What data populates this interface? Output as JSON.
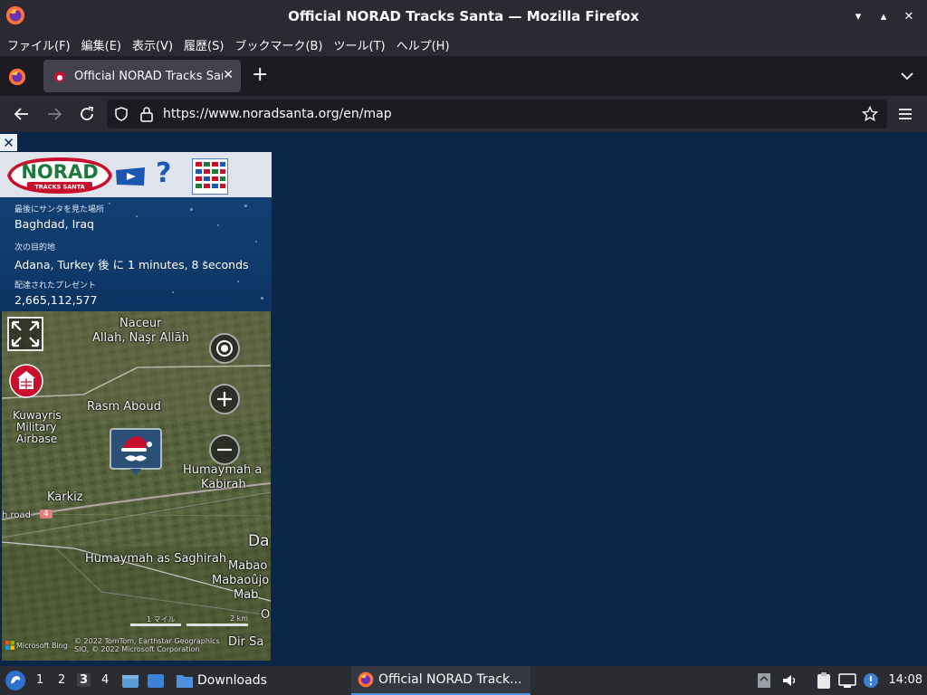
{
  "window": {
    "title": "Official NORAD Tracks Santa — Mozilla Firefox",
    "controls": [
      "▾",
      "▴",
      "✕"
    ]
  },
  "menubar": {
    "items": [
      "ファイル(F)",
      "編集(E)",
      "表示(V)",
      "履歴(S)",
      "ブックマーク(B)",
      "ツール(T)",
      "ヘルプ(H)"
    ]
  },
  "tabs": {
    "active_title": "Official NORAD Tracks Santa",
    "close": "✕",
    "new_tab": "+"
  },
  "navbar": {
    "url": "https://www.noradsanta.org/en/map"
  },
  "page": {
    "close": "✕",
    "help": "?",
    "logo_text": "NORAD",
    "logo_sub": "TRACKS SANTA",
    "last_seen_label": "最後にサンタを見た場所",
    "last_seen_value": "Baghdad, Iraq",
    "next_stop_label": "次の目的地",
    "next_stop_value": "Adana, Turkey 後 に 1 minutes, 8 seconds",
    "gifts_label": "配達されたプレゼント",
    "gifts_value": "2,665,112,577"
  },
  "map": {
    "labels": {
      "naceur": "Naceur",
      "allah": "Allah, Naşr Allāh",
      "rasm": "Rasm Aboud",
      "kuwayris1": "Kuwayris",
      "kuwayris2": "Military",
      "kuwayris3": "Airbase",
      "humaymah_a": "Humaymah a",
      "kabirah": "Kabirah",
      "karkiz": "Karkiz",
      "road": "h road",
      "road_num": "4",
      "humaymah_s": "Humaymah as Saghirah",
      "da": "Da",
      "mabao": "Mabao",
      "mabaoujo": "Mabaoûjo",
      "mab": "Mab",
      "o": "O",
      "dirsa": "Dir Sa"
    },
    "scale_mi": "1 マイル",
    "scale_km": "2 km",
    "attribution": "© 2022 TomTom, Earthstar Geographics SIO, © 2022 Microsoft Corporation",
    "bing": "Microsoft Bing"
  },
  "taskbar": {
    "workspaces": [
      "1",
      "2",
      "3",
      "4"
    ],
    "active_workspace": "3",
    "downloads": "Downloads",
    "task_title": "Official NORAD Track...",
    "clock": "14:08"
  }
}
